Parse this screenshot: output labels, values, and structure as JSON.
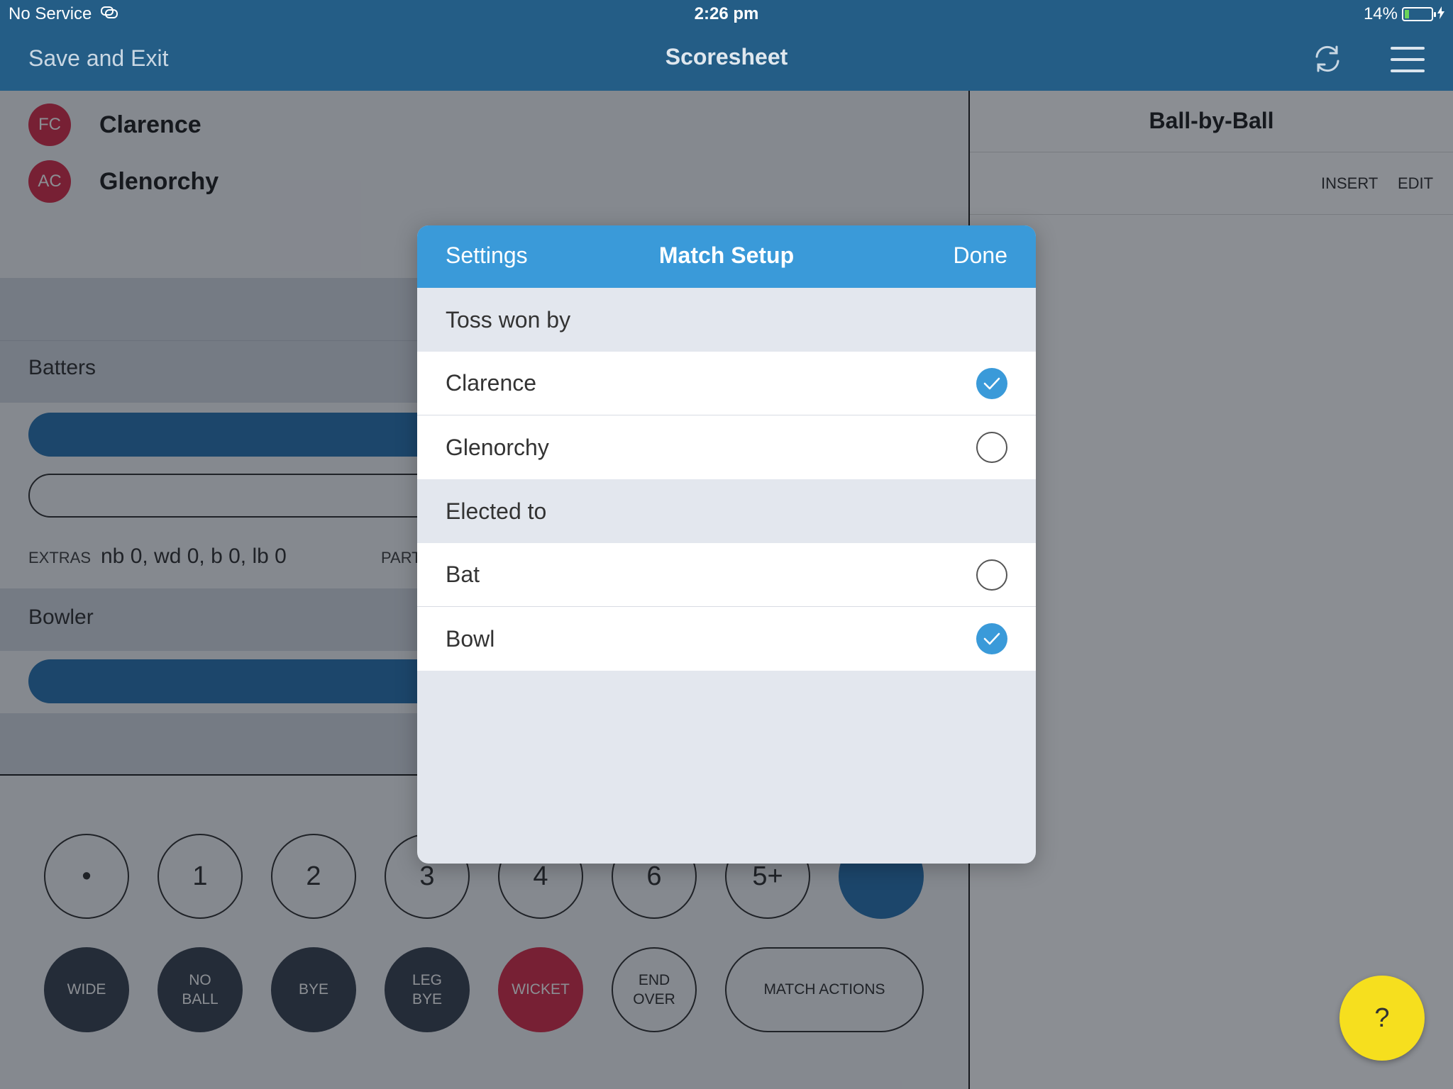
{
  "status_bar": {
    "carrier": "No Service",
    "time": "2:26 pm",
    "battery": "14%",
    "battery_level": 0.14
  },
  "nav": {
    "save_exit": "Save and Exit",
    "title": "Scoresheet"
  },
  "teams": [
    {
      "badge": "FC",
      "name": "Clarence"
    },
    {
      "badge": "AC",
      "name": "Glenorchy"
    }
  ],
  "batters": {
    "label": "Batters"
  },
  "extras": {
    "label": "EXTRAS",
    "value": "nb 0, wd 0, b 0, lb 0",
    "partnership_label": "PARTN"
  },
  "bowler": {
    "label": "Bowler"
  },
  "run_buttons": [
    "•",
    "1",
    "2",
    "3",
    "4",
    "6",
    "5+"
  ],
  "action_buttons": [
    {
      "line1": "WIDE",
      "line2": ""
    },
    {
      "line1": "NO",
      "line2": "BALL"
    },
    {
      "line1": "BYE",
      "line2": ""
    },
    {
      "line1": "LEG",
      "line2": "BYE"
    },
    {
      "line1": "WICKET",
      "line2": ""
    },
    {
      "line1": "END",
      "line2": "OVER"
    }
  ],
  "match_actions": "MATCH ACTIONS",
  "ball_by_ball": {
    "title": "Ball-by-Ball",
    "insert": "INSERT",
    "edit": "EDIT"
  },
  "help": "?",
  "modal": {
    "settings": "Settings",
    "title": "Match Setup",
    "done": "Done",
    "toss_label": "Toss won by",
    "toss_options": [
      {
        "label": "Clarence",
        "selected": true
      },
      {
        "label": "Glenorchy",
        "selected": false
      }
    ],
    "elected_label": "Elected to",
    "elected_options": [
      {
        "label": "Bat",
        "selected": false
      },
      {
        "label": "Bowl",
        "selected": true
      }
    ]
  },
  "colors": {
    "brand_navy": "#245d86",
    "modal_blue": "#3a9ad9",
    "badge_red": "#d9304c",
    "wicket_red": "#d9304c",
    "help_yellow": "#f6df1e"
  }
}
